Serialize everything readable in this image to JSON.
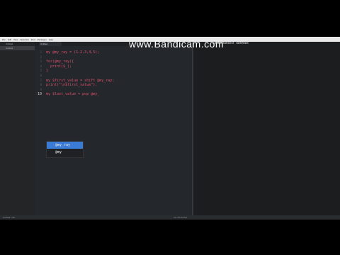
{
  "menubar": {
    "items": [
      "File",
      "Edit",
      "View",
      "Selection",
      "Find",
      "Packages",
      "Help"
    ]
  },
  "sidebar": {
    "items": [
      "Untitled",
      "Untitled"
    ]
  },
  "tab": {
    "label": "Untitled"
  },
  "code": {
    "lines": [
      {
        "n": "1",
        "text": "my @my_ray = (1,2,3,4,5);",
        "cls": "red"
      },
      {
        "n": "2",
        "text": "",
        "cls": "plain"
      },
      {
        "n": "3",
        "text": "for(@my_ray){",
        "cls": "red"
      },
      {
        "n": "4",
        "text": "  print($_);",
        "cls": "red"
      },
      {
        "n": "5",
        "text": "}",
        "cls": "red"
      },
      {
        "n": "6",
        "text": "",
        "cls": "plain"
      },
      {
        "n": "7",
        "text": "my $first_value = shift @my_ray;",
        "cls": "red"
      },
      {
        "n": "8",
        "text": "print(\"\\n$first_value\");",
        "cls": "red"
      },
      {
        "n": "9",
        "text": "",
        "cls": "plain"
      },
      {
        "n": "10",
        "text": "my $last_value = pop @my_",
        "cls": "red"
      }
    ]
  },
  "autocomplete": {
    "items": [
      "@my_ray",
      "@my"
    ],
    "selected_index": 0
  },
  "watermark": {
    "text": "www.Bandicam.com",
    "subtitle": "Derekbanas's Tutorials"
  },
  "status": {
    "left": "Untitled  1:25",
    "right": "LF  UTF-8  Perl"
  }
}
